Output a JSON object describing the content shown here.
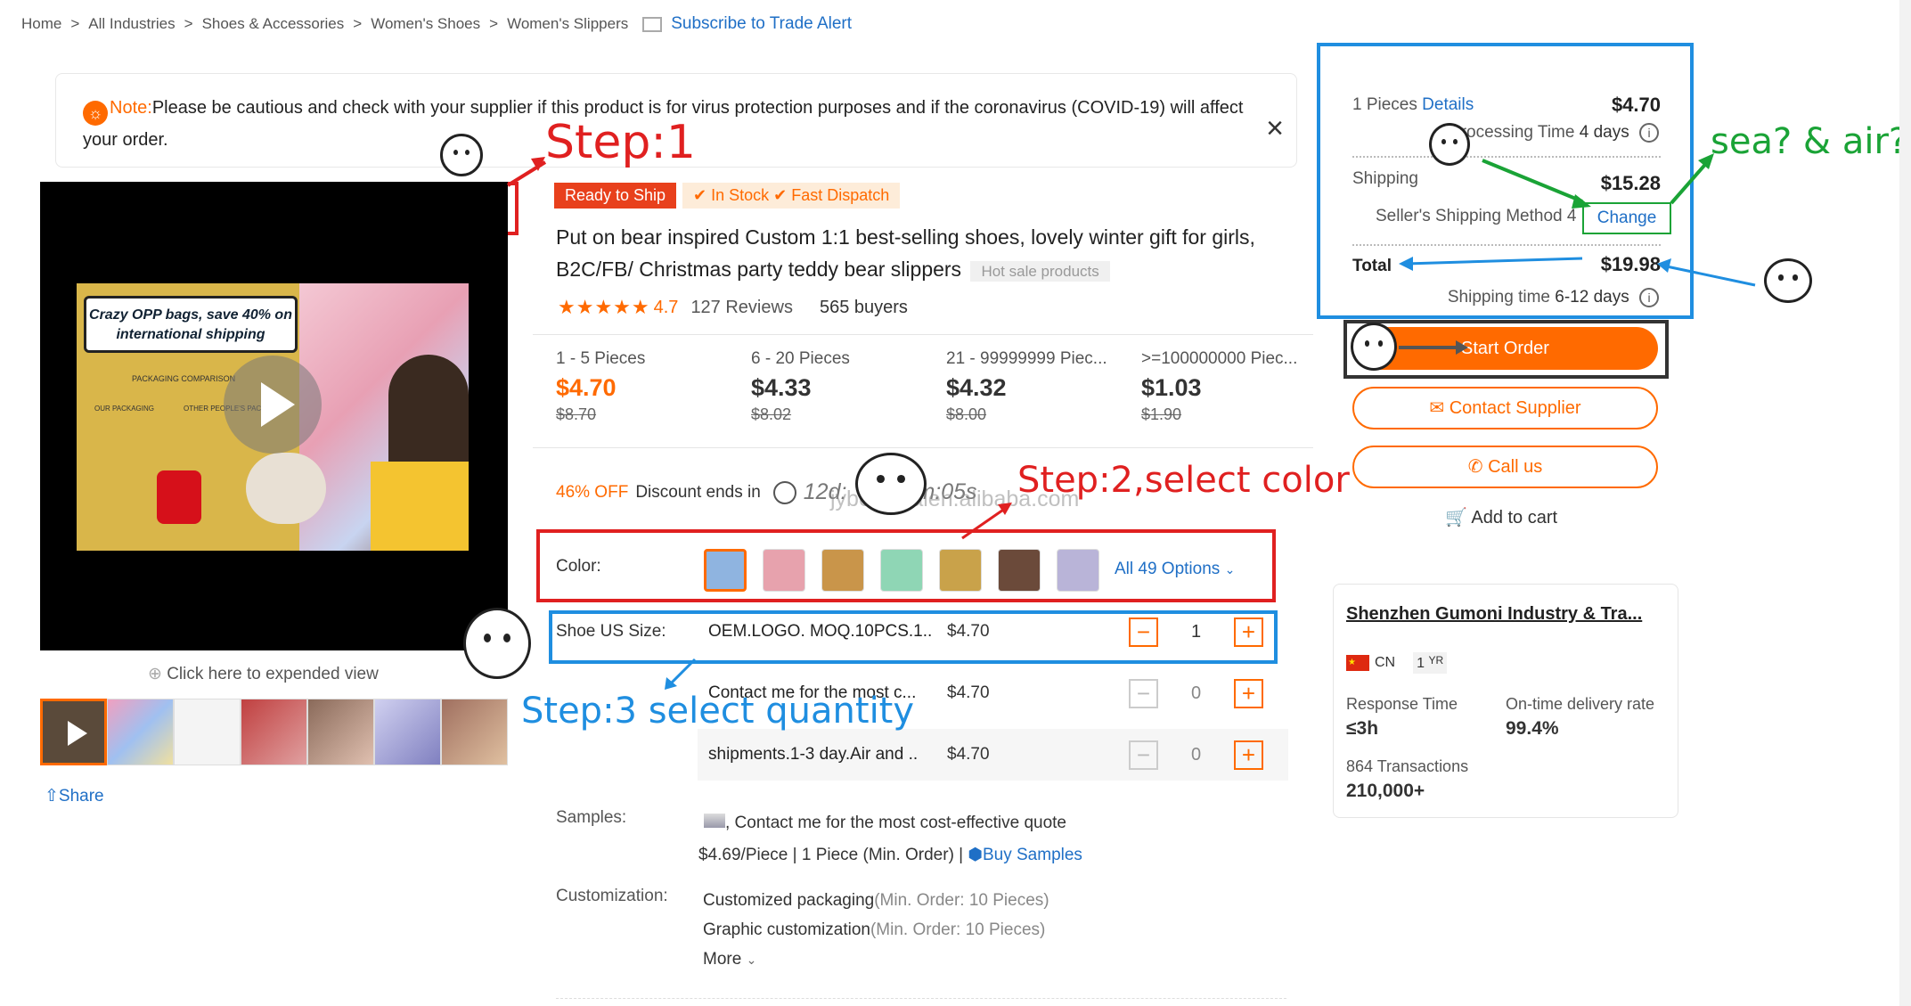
{
  "breadcrumb": {
    "items": [
      "Home",
      "All Industries",
      "Shoes & Accessories",
      "Women's Shoes",
      "Women's Slippers"
    ],
    "separator": ">",
    "subscribe": "Subscribe to Trade Alert"
  },
  "notice": {
    "label": "Note:",
    "text": "Please be cautious and check with your supplier if this product is for virus protection purposes and if the coronavirus (COVID-19) will affect your order."
  },
  "gallery": {
    "expand": "Click here to expended view",
    "share": "Share",
    "promo_line1": "Crazy OPP bags, save 40% on",
    "promo_line2": "international shipping",
    "packaging_comparison": "PACKAGING COMPARISON",
    "our_packaging": "OUR PACKAGING",
    "other_packaging": "OTHER PEOPLE'S PACKA..."
  },
  "product": {
    "badge_ship": "Ready to Ship",
    "in_stock": "In Stock",
    "fast_dispatch": "Fast Dispatch",
    "title_line1": "Put on bear inspired Custom 1:1 best-selling shoes, lovely winter gift for girls,",
    "title_line2": "B2C/FB/ Christmas party teddy bear slippers",
    "hot_tag": "Hot sale products",
    "rating": "4.7",
    "reviews": "127 Reviews",
    "buyers": "565 buyers",
    "stars": 4.7
  },
  "tiers": [
    {
      "range": "1 - 5 Pieces",
      "price": "$4.70",
      "old": "$8.70"
    },
    {
      "range": "6 - 20 Pieces",
      "price": "$4.33",
      "old": "$8.02"
    },
    {
      "range": "21 - 99999999 Piec...",
      "price": "$4.32",
      "old": "$8.00"
    },
    {
      "range": ">=100000000 Piec...",
      "price": "$1.03",
      "old": "$1.90"
    }
  ],
  "discount": {
    "off": "46% OFF",
    "label": "Discount ends in",
    "timer": "12d:",
    "timer_tail": "m:05s",
    "watermark": "jybeilindalen.alibaba.com"
  },
  "color": {
    "label": "Color:",
    "all": "All 49 Options",
    "swatches": [
      "#8fb4e0",
      "#e7a2ad",
      "#c9954a",
      "#8fd6b5",
      "#c9a24a",
      "#6b4a3a",
      "#b9b4d8"
    ]
  },
  "size": {
    "label": "Shoe US Size:",
    "rows": [
      {
        "name": "OEM.LOGO. MOQ.10PCS.1..",
        "price": "$4.70",
        "qty": "1"
      },
      {
        "name": "Contact me for the most c...",
        "price": "$4.70",
        "qty": "0"
      },
      {
        "name": "shipments.1-3 day.Air and ..",
        "price": "$4.70",
        "qty": "0"
      }
    ]
  },
  "samples": {
    "label": "Samples:",
    "line1": ", Contact me for the most cost-effective quote",
    "line2": "$4.69/Piece | 1 Piece (Min. Order) |",
    "buy": "Buy Samples"
  },
  "customization": {
    "label": "Customization:",
    "opt1": "Customized packaging",
    "opt1_note": "(Min. Order: 10 Pieces)",
    "opt2": "Graphic customization",
    "opt2_note": "(Min. Order: 10 Pieces)",
    "more": "More"
  },
  "summary": {
    "pieces": "1 Pieces",
    "details": "Details",
    "piece_price": "$4.70",
    "processing": "Processing Time",
    "processing_days": "4 days",
    "shipping": "Shipping",
    "shipping_price": "$15.28",
    "method_label": "Seller's Shipping Method 4",
    "change": "Change",
    "total": "Total",
    "total_price": "$19.98",
    "ship_time": "Shipping time",
    "ship_days": "6-12 days"
  },
  "actions": {
    "start": "Start Order",
    "contact": "Contact Supplier",
    "call": "Call us",
    "cart": "Add to cart"
  },
  "supplier": {
    "name": "Shenzhen Gumoni Industry & Tra...",
    "country": "CN",
    "years": "1",
    "years_unit": "YR",
    "response_label": "Response Time",
    "response": "≤3h",
    "ontime_label": "On-time delivery rate",
    "ontime": "99.4%",
    "transactions_label": "864 Transactions",
    "transactions": "210,000+"
  },
  "annotations": {
    "step1": "Step:1",
    "step2": "Step:2,select color",
    "step3": "Step:3 select quantity",
    "sea_air": "sea? & air?"
  },
  "colors": {
    "accent": "#ff6a00",
    "link": "#1f6fc6",
    "red_annot": "#e02020",
    "blue_annot": "#1f8ee0",
    "green_annot": "#1aa336"
  }
}
